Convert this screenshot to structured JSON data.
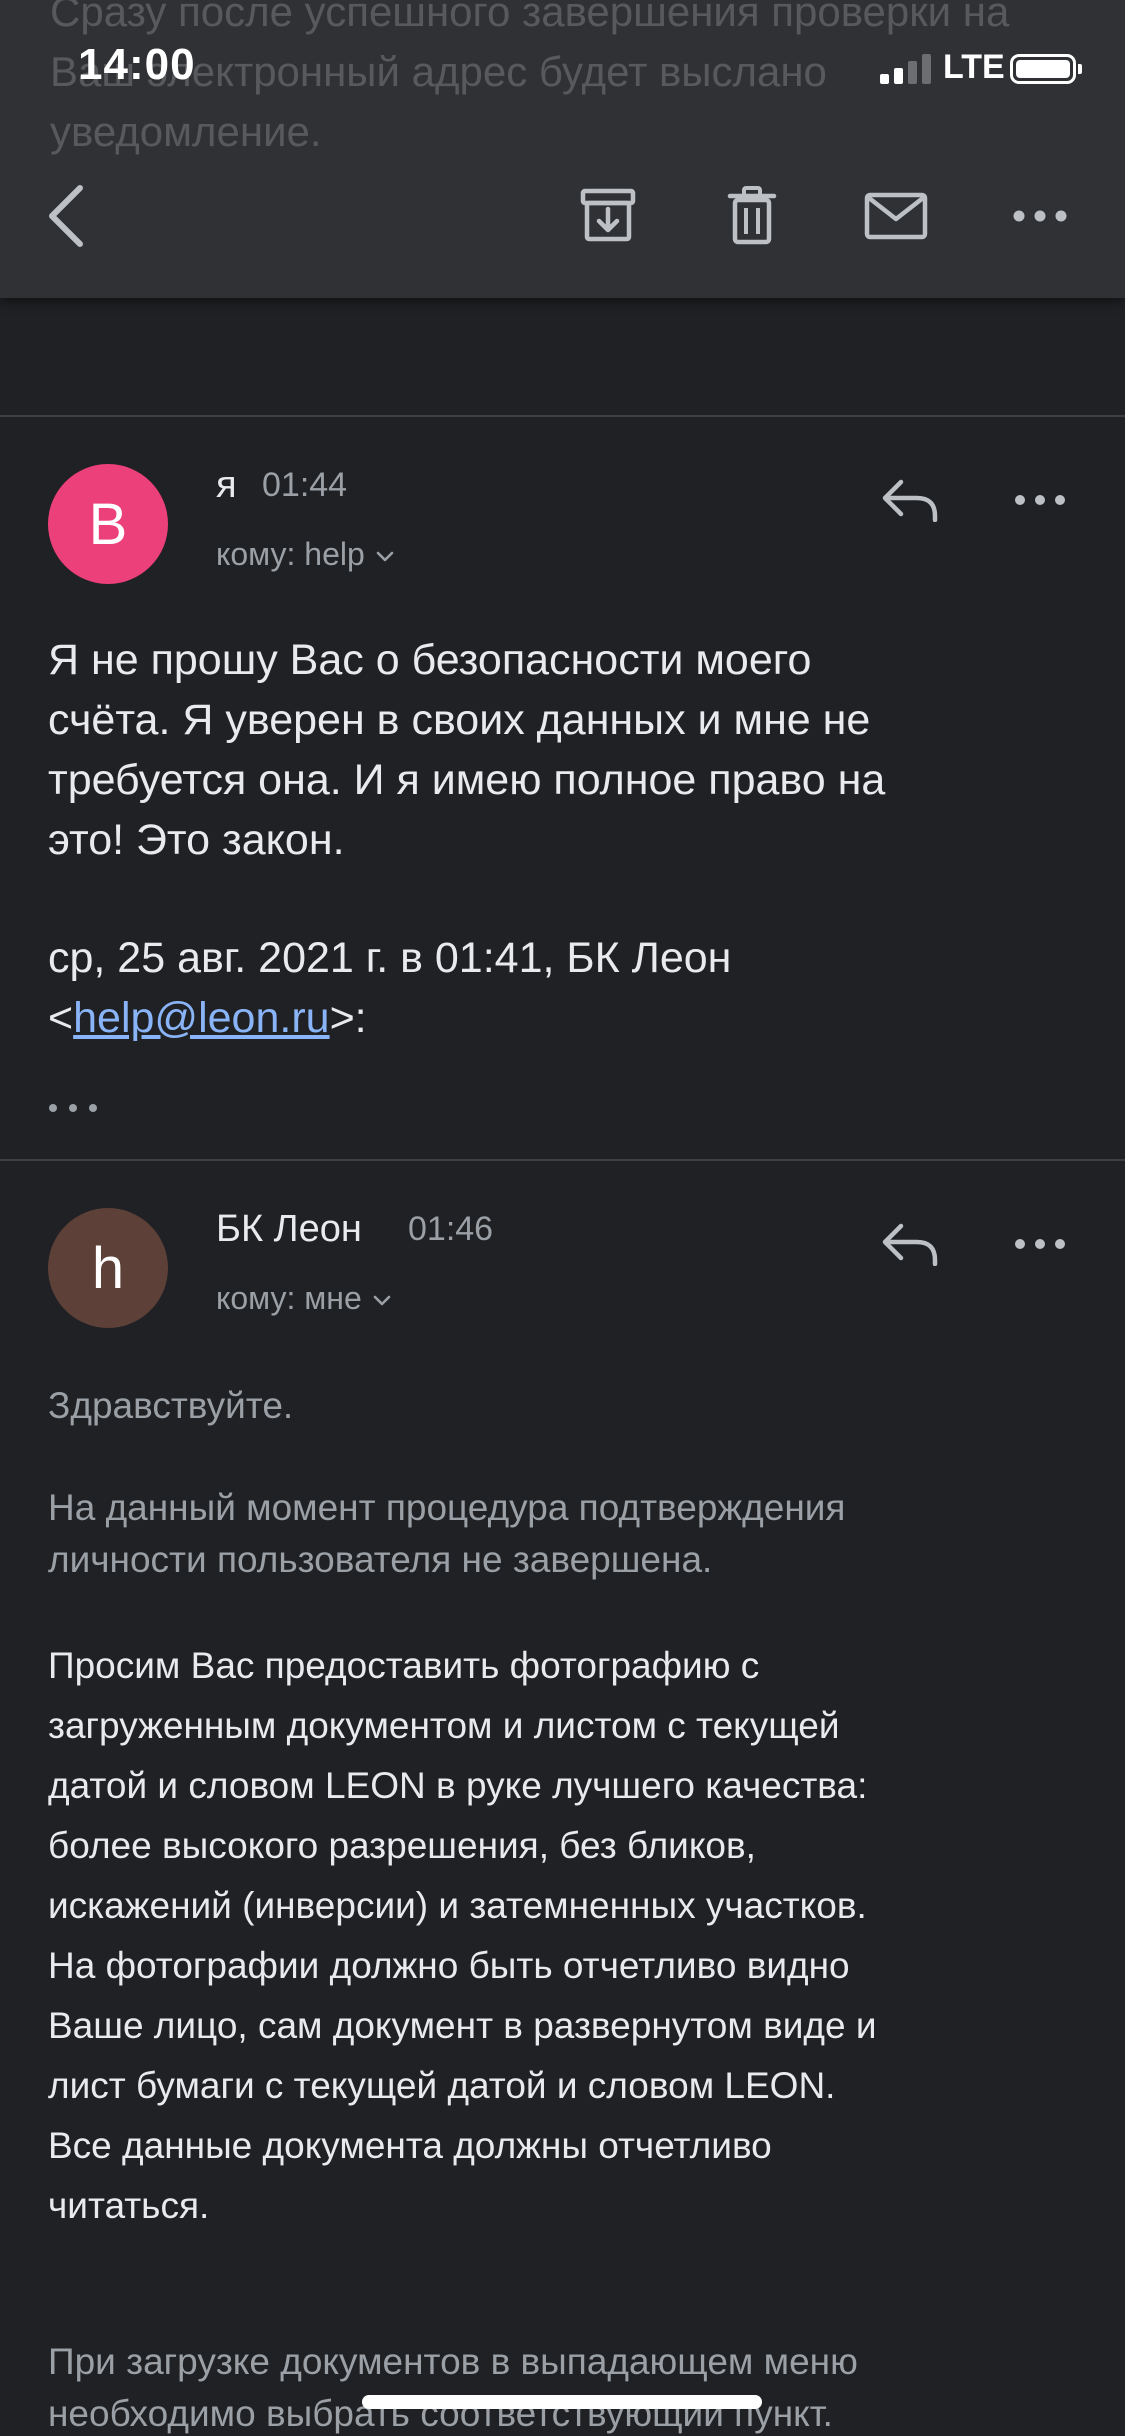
{
  "status_bar": {
    "time": "14:00",
    "network": "LTE"
  },
  "background_preview": {
    "lines": [
      "Сразу после успешного завершения проверки на",
      "Ваш электронный адрес будет выслано",
      "уведомление."
    ]
  },
  "toolbar": {
    "icons": [
      "back-arrow-icon",
      "archive-icon",
      "trash-icon",
      "mail-icon",
      "more-icon"
    ]
  },
  "messages": [
    {
      "avatar_letter": "B",
      "avatar_color": "#ec407a",
      "sender": "я",
      "time": "01:44",
      "recipient": "кому: help",
      "body_lines": [
        "Я не прошу Вас о безопасности моего",
        "счёта. Я уверен в своих данных и мне не",
        "требуется она. И я имею полное право на",
        "это! Это закон."
      ],
      "quote_line1": "ср, 25 авг. 2021 г. в 01:41, БК Леон",
      "quote_open": "<",
      "quote_email": "help@leon.ru",
      "quote_close": ">:",
      "ellipsis": "•••"
    },
    {
      "avatar_letter": "h",
      "avatar_color": "#5d4037",
      "sender": "БК Леон",
      "time": "01:46",
      "recipient": "кому: мне",
      "greeting": "Здравствуйте.",
      "notice_lines": [
        "На данный момент процедура подтверждения",
        "личности пользователя не завершена."
      ],
      "request_lines": [
        "Просим Вас предоставить фотографию с",
        "загруженным документом и листом с текущей",
        "датой и словом LEON в руке лучшего качества:",
        "более высокого разрешения, без бликов,",
        "искажений (инверсии) и затемненных участков.",
        "На фотографии должно быть отчетливо видно",
        "Ваше лицо, сам документ в развернутом виде и",
        "лист бумаги с текущей датой и словом LEON.",
        "Все данные документа должны отчетливо",
        "читаться."
      ],
      "upload_lines": [
        "При загрузке документов в выпадающем меню",
        "необходимо выбрать соответствующий пункт."
      ]
    }
  ],
  "colors": {
    "background": "#202124",
    "toolbar": "#303134",
    "link": "#8ab4f8"
  }
}
